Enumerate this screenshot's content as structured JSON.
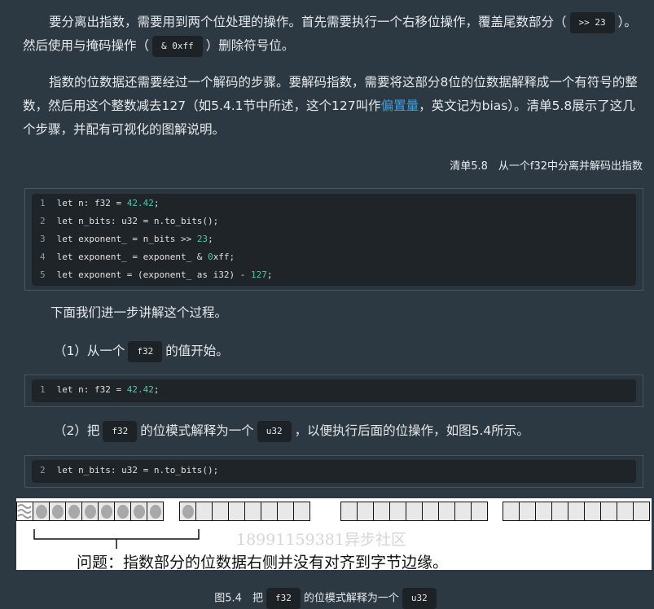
{
  "para1": {
    "t1": "要分离出指数，需要用到两个位处理的操作。首先需要执行一个右移位操作，覆盖尾数部分（",
    "code1": ">> 23",
    "t2": "）。然后使用与掩码操作（",
    "code2": "& 0xff",
    "t3": "）删除符号位。"
  },
  "para2": {
    "t1": "指数的位数据还需要经过一个解码的步骤。要解码指数，需要将这部分8位的位数据解释成一个有符号的整数，然后用这个整数减去127（如5.4.1节中所述，这个127叫作",
    "link": "偏置量",
    "t2": "，英文记为bias）。清单5.8展示了这几个步骤，并配有可视化的图解说明。"
  },
  "listing_caption": "清单5.8　从一个f32中分离并解码出指数",
  "code_lines": [
    {
      "n": "1",
      "a": "let n: f32 = ",
      "num": "42.42",
      "b": ";"
    },
    {
      "n": "2",
      "a": "let n_bits: u32 = n.to_bits();",
      "num": "",
      "b": ""
    },
    {
      "n": "3",
      "a": "let exponent_ = n_bits >> ",
      "num": "23",
      "b": ";"
    },
    {
      "n": "4",
      "a": "let exponent_ = exponent_ & ",
      "num": "0",
      "b": "xff;"
    },
    {
      "n": "5",
      "a": "let exponent = (exponent_ as i32) - ",
      "num": "127",
      "b": ";"
    }
  ],
  "intro": "下面我们进一步讲解这个过程。",
  "step1": {
    "t1": "（1）从一个",
    "code": "f32",
    "t2": "的值开始。"
  },
  "step1_code": {
    "n": "1",
    "a": "let n: f32 = ",
    "num": "42.42",
    "b": ";"
  },
  "step2": {
    "t1": "（2）把",
    "code1": "f32",
    "t2": "的位模式解释为一个",
    "code2": "u32",
    "t3": "，以便执行后面的位操作，如图5.4所示。"
  },
  "step2_code": {
    "n": "2",
    "a": "let n_bits: u32 = n.to_bits();"
  },
  "figure": {
    "watermark": "18991159381异步社区",
    "problem": "问题：指数部分的位数据右侧并没有对齐到字节边缘。"
  },
  "fig_caption": {
    "t1": "图5.4　把",
    "code1": "f32",
    "t2": "的位模式解释为一个",
    "code2": "u32"
  }
}
